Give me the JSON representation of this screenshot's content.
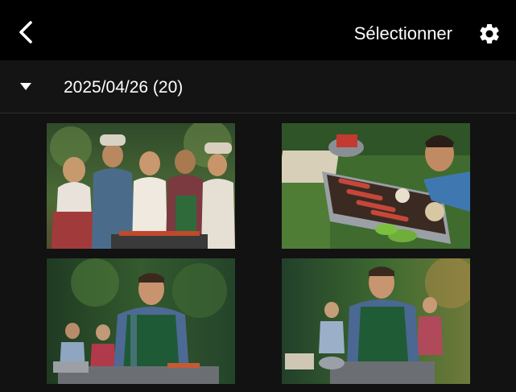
{
  "header": {
    "back_icon": "chevron-left-icon",
    "select_label": "Sélectionner",
    "settings_icon": "gear-icon"
  },
  "section": {
    "collapse_icon": "caret-down-icon",
    "date_label": "2025/04/26 (20)"
  },
  "photos": [
    {
      "subject": "friends-bbq-group"
    },
    {
      "subject": "man-grilling-sausages"
    },
    {
      "subject": "man-in-apron-at-grill"
    },
    {
      "subject": "man-serving-food-at-grill"
    }
  ],
  "colors": {
    "topbar": "#000000",
    "background": "#121212",
    "text": "#ffffff"
  }
}
